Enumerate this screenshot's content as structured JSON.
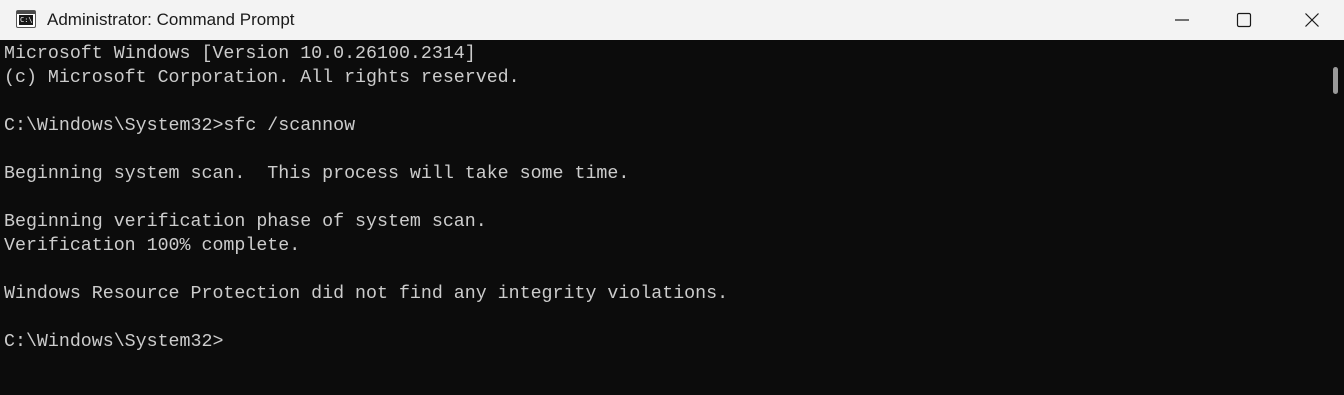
{
  "window": {
    "title": "Administrator: Command Prompt",
    "icon": "command-prompt-icon",
    "icon_text": "C:\\",
    "caption_buttons": [
      "minimize-icon",
      "maximize-icon",
      "close-icon"
    ]
  },
  "console": {
    "lines": [
      "Microsoft Windows [Version 10.0.26100.2314]",
      "(c) Microsoft Corporation. All rights reserved.",
      "",
      "C:\\Windows\\System32>sfc /scannow",
      "",
      "Beginning system scan.  This process will take some time.",
      "",
      "Beginning verification phase of system scan.",
      "Verification 100% complete.",
      "",
      "Windows Resource Protection did not find any integrity violations.",
      "",
      "C:\\Windows\\System32>"
    ]
  },
  "colors": {
    "console_background": "#0c0c0c",
    "console_text": "#cccccc",
    "titlebar_background": "#f3f3f3",
    "title_text": "#1a1a1a"
  }
}
